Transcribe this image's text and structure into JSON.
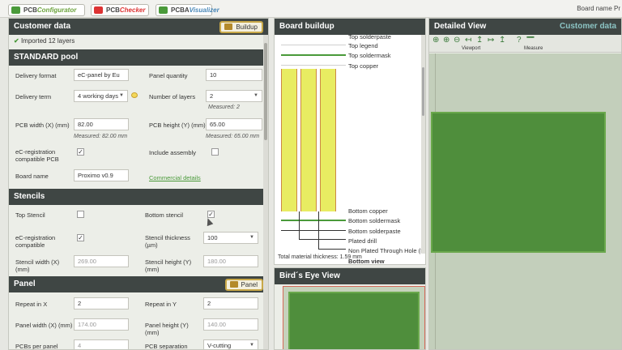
{
  "tabs": [
    {
      "prefix": "PCB",
      "name": "Configurator"
    },
    {
      "prefix": "PCB",
      "name": "Checker"
    },
    {
      "prefix": "PCBA",
      "name": "Visualizer"
    }
  ],
  "board_name_label": "Board name Pr",
  "customer": {
    "title": "Customer data",
    "buildup_button": "Buildup",
    "imported": "Imported 12 layers"
  },
  "standard_pool": {
    "title": "STANDARD pool",
    "delivery_format_label": "Delivery format",
    "delivery_format_value": "eC-panel by Eu",
    "panel_quantity_label": "Panel quantity",
    "panel_quantity_value": "10",
    "delivery_term_label": "Delivery term",
    "delivery_term_value": "4 working days",
    "number_of_layers_label": "Number of layers",
    "number_of_layers_value": "2",
    "measured_layers": "Measured: 2",
    "pcb_width_label": "PCB width (X) (mm)",
    "pcb_width_value": "82.00",
    "measured_width": "Measured: 82.00 mm",
    "pcb_height_label": "PCB height (Y) (mm)",
    "pcb_height_value": "65.00",
    "measured_height": "Measured: 65.00 mm",
    "ereg_label": "eC-registration compatible PCB",
    "include_assembly_label": "Include assembly",
    "board_name_label": "Board name",
    "board_name_value": "Proximo v0.9",
    "commercial_details": "Commercial details"
  },
  "stencils": {
    "title": "Stencils",
    "top_stencil_label": "Top Stencil",
    "bottom_stencil_label": "Bottom stencil",
    "ereg_label": "eC-registration compatible",
    "thickness_label": "Stencil thickness (µm)",
    "thickness_value": "100",
    "width_label": "Stencil width (X) (mm)",
    "width_value": "269.00",
    "height_label": "Stencil height (Y) (mm)",
    "height_value": "180.00"
  },
  "panel": {
    "title": "Panel",
    "button": "Panel",
    "repeat_x_label": "Repeat in X",
    "repeat_x_value": "2",
    "repeat_y_label": "Repeat in Y",
    "repeat_y_value": "2",
    "width_label": "Panel width (X) (mm)",
    "width_value": "174.00",
    "height_label": "Panel height (Y) (mm)",
    "height_value": "140.00",
    "pcbs_label": "PCBs per panel",
    "pcbs_value": "4",
    "separation_label": "PCB separation",
    "separation_value": "V-cutting"
  },
  "buildup": {
    "title": "Board buildup",
    "top_layers": [
      "Top solderpaste",
      "Top legend",
      "Top soldermask",
      "Top copper"
    ],
    "bottom_layers": [
      "Bottom copper",
      "Bottom soldermask",
      "Bottom solderpaste",
      "Plated drill",
      "Non Plated Through Hole (N"
    ],
    "bottom_view": "Bottom view",
    "thickness": "Total material thickness: 1.59 mm"
  },
  "birds_eye": {
    "title": "Bird´s Eye View"
  },
  "detailed": {
    "title": "Detailed View",
    "customer_link": "Customer data",
    "viewport_label": "Viewport",
    "measure_label": "Measure"
  },
  "colors": {
    "header": "#3f4644",
    "accent": "#4a9a3a",
    "pcb": "#4f8e3c"
  }
}
